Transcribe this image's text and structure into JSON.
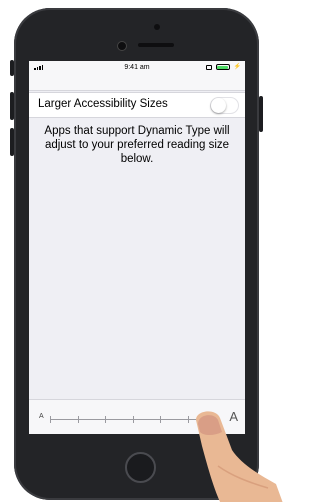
{
  "status_bar": {
    "time": "9:41 am",
    "icons": [
      "signal-icon",
      "screen-mirroring-icon",
      "battery-icon",
      "charging-bolt-icon"
    ],
    "battery_color": "#4cd964"
  },
  "settings": {
    "larger_sizes_label": "Larger Accessibility Sizes",
    "larger_sizes_on": false,
    "description": "Apps that support Dynamic Type will adjust to your preferred reading size below."
  },
  "text_size_slider": {
    "small_label": "A",
    "large_label": "A",
    "tick_count": 7,
    "selected_step": 7
  },
  "colors": {
    "screen_background": "#efeff4",
    "row_background": "#ffffff",
    "phone_body": "#232427"
  }
}
